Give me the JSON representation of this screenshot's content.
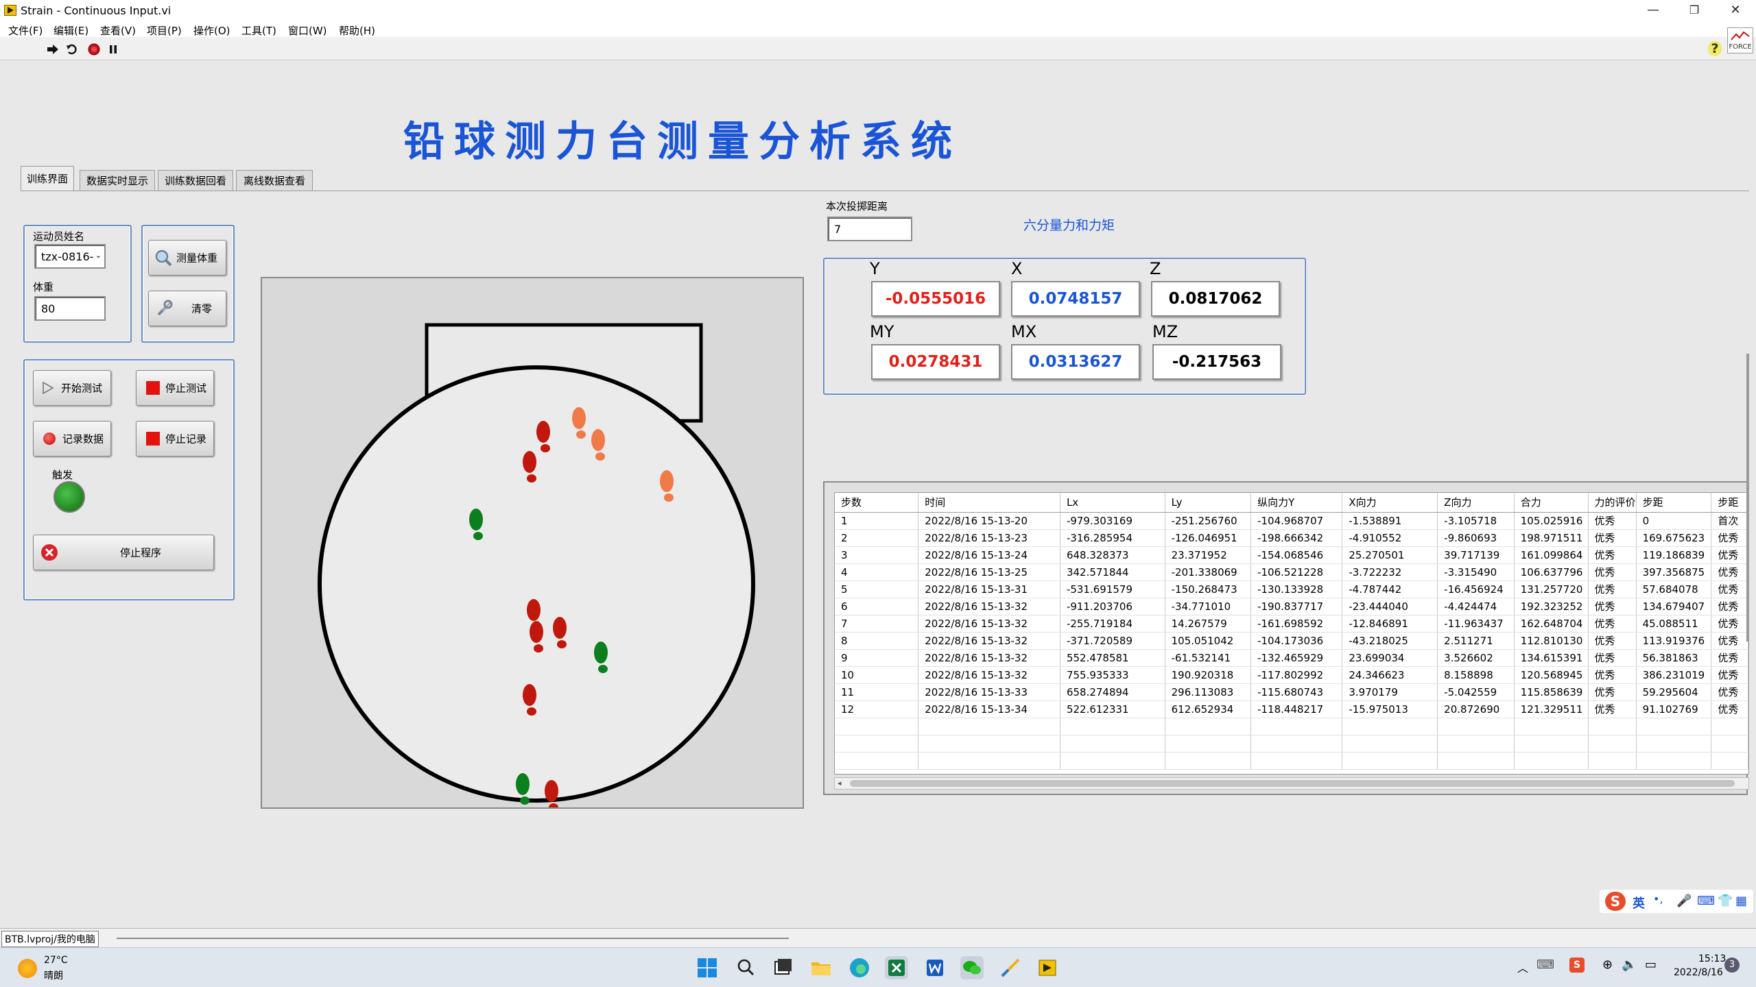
{
  "window": {
    "title": "Strain - Continuous Input.vi",
    "min_glyph": "—",
    "max_glyph": "❐",
    "close_glyph": "✕"
  },
  "menu": [
    "文件(F)",
    "编辑(E)",
    "查看(V)",
    "项目(P)",
    "操作(O)",
    "工具(T)",
    "窗口(W)",
    "帮助(H)"
  ],
  "toolbar": {
    "run_icon": "run-arrow-icon",
    "run_continuous_icon": "run-continuously-icon",
    "abort_icon": "abort-icon",
    "pause_icon": "pause-icon",
    "help_glyph": "?",
    "logo_text": "FORCE"
  },
  "heading": "铅球测力台测量分析系统",
  "tabs": [
    {
      "label": "训练界面",
      "active": true
    },
    {
      "label": "数据实时显示",
      "active": false
    },
    {
      "label": "训练数据回看",
      "active": false
    },
    {
      "label": "离线数据查看",
      "active": false
    }
  ],
  "athlete": {
    "name_label": "运动员姓名",
    "name_value": "tzx-0816-",
    "weight_label": "体重",
    "weight_value": "80"
  },
  "buttons": {
    "measure_weight": "测量体重",
    "zero": "清零",
    "start_test": "开始测试",
    "stop_test": "停止测试",
    "record_data": "记录数据",
    "stop_record": "停止记录",
    "trigger_label": "触发",
    "stop_program": "停止程序"
  },
  "throw_distance": {
    "label": "本次投掷距离",
    "value": "7"
  },
  "six_axis": {
    "title": "六分量力和力矩",
    "Y": {
      "label": "Y",
      "value": "-0.0555016",
      "color": "#e0201b"
    },
    "X": {
      "label": "X",
      "value": "0.0748157",
      "color": "#1a55d6"
    },
    "Z": {
      "label": "Z",
      "value": "0.0817062",
      "color": "#000000"
    },
    "MY": {
      "label": "MY",
      "value": "0.0278431",
      "color": "#e0201b"
    },
    "MX": {
      "label": "MX",
      "value": "0.0313627",
      "color": "#1a55d6"
    },
    "MZ": {
      "label": "MZ",
      "value": "-0.217563",
      "color": "#000000"
    }
  },
  "table": {
    "headers": [
      "步数",
      "时间",
      "Lx",
      "Ly",
      "纵向力Y",
      "X向力",
      "Z向力",
      "合力",
      "力的评价",
      "步距",
      "步距"
    ],
    "rows": [
      [
        "1",
        "2022/8/16  15-13-20",
        "-979.303169",
        "-251.256760",
        "-104.968707",
        "-1.538891",
        "-3.105718",
        "105.025916",
        "优秀",
        "0",
        "首次"
      ],
      [
        "2",
        "2022/8/16  15-13-23",
        "-316.285954",
        "-126.046951",
        "-198.666342",
        "-4.910552",
        "-9.860693",
        "198.971511",
        "优秀",
        "169.675623",
        "优秀"
      ],
      [
        "3",
        "2022/8/16  15-13-24",
        "648.328373",
        "23.371952",
        "-154.068546",
        "25.270501",
        "39.717139",
        "161.099864",
        "优秀",
        "119.186839",
        "优秀"
      ],
      [
        "4",
        "2022/8/16  15-13-25",
        "342.571844",
        "-201.338069",
        "-106.521228",
        "-3.722232",
        "-3.315490",
        "106.637796",
        "优秀",
        "397.356875",
        "优秀"
      ],
      [
        "5",
        "2022/8/16  15-13-31",
        "-531.691579",
        "-150.268473",
        "-130.133928",
        "-4.787442",
        "-16.456924",
        "131.257720",
        "优秀",
        "57.684078",
        "优秀"
      ],
      [
        "6",
        "2022/8/16  15-13-32",
        "-911.203706",
        "-34.771010",
        "-190.837717",
        "-23.444040",
        "-4.424474",
        "192.323252",
        "优秀",
        "134.679407",
        "优秀"
      ],
      [
        "7",
        "2022/8/16  15-13-32",
        "-255.719184",
        "14.267579",
        "-161.698592",
        "-12.846891",
        "-11.963437",
        "162.648704",
        "优秀",
        "45.088511",
        "优秀"
      ],
      [
        "8",
        "2022/8/16  15-13-32",
        "-371.720589",
        "105.051042",
        "-104.173036",
        "-43.218025",
        "2.511271",
        "112.810130",
        "优秀",
        "113.919376",
        "优秀"
      ],
      [
        "9",
        "2022/8/16  15-13-32",
        "552.478581",
        "-61.532141",
        "-132.465929",
        "23.699034",
        "3.526602",
        "134.615391",
        "优秀",
        "56.381863",
        "优秀"
      ],
      [
        "10",
        "2022/8/16  15-13-32",
        "755.935333",
        "190.920318",
        "-117.802992",
        "24.346623",
        "8.158898",
        "120.568945",
        "优秀",
        "386.231019",
        "优秀"
      ],
      [
        "11",
        "2022/8/16  15-13-33",
        "658.274894",
        "296.113083",
        "-115.680743",
        "3.970179",
        "-5.042559",
        "115.858639",
        "优秀",
        "59.295604",
        "优秀"
      ],
      [
        "12",
        "2022/8/16  15-13-34",
        "522.612331",
        "612.652934",
        "-118.448217",
        "-15.975013",
        "20.872690",
        "121.329511",
        "优秀",
        "91.102769",
        "优秀"
      ]
    ],
    "empty_rows": 3
  },
  "colors": {
    "footprint_dark_red": "#c0180c",
    "footprint_orange": "#f07a48",
    "footprint_green": "#0b7f1d",
    "heading_blue": "#1a55d6",
    "group_border": "#6a8dc8",
    "trigger_led": "#1b8a1b"
  },
  "status": {
    "project_path": "BTB.lvproj/我的电脑"
  },
  "ime": {
    "lang": "英",
    "punct": "•,"
  },
  "taskbar": {
    "weather_temp": "27°C",
    "weather_desc": "晴朗",
    "time": "15:13",
    "date": "2022/8/16",
    "notify_count": "3"
  }
}
